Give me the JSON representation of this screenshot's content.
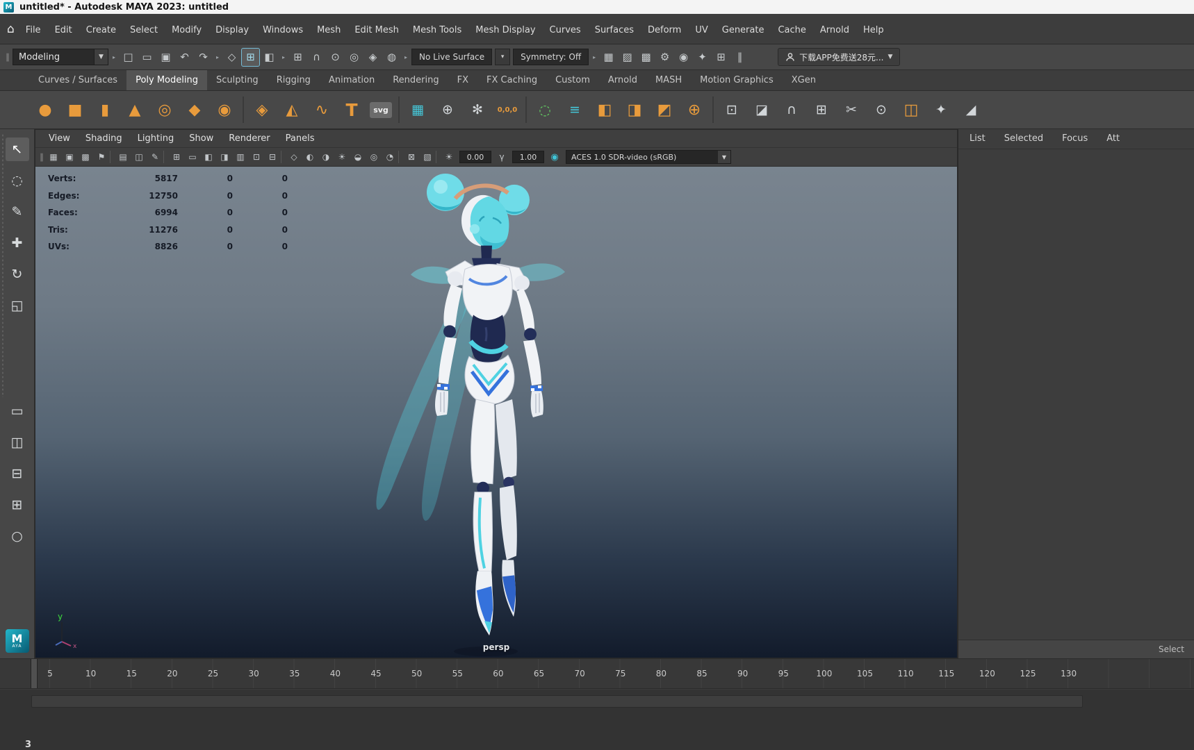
{
  "title_bar": {
    "title": "untitled* - Autodesk MAYA 2023: untitled",
    "app_icon": "M"
  },
  "icons": {
    "home": "⌂",
    "down_arrow": "▼",
    "dropdown_arrow": "▾",
    "grip": "∥",
    "separator_arrow": "▸",
    "gamma": "γ",
    "color_mgmt": "◉"
  },
  "menu_bar": {
    "items": [
      "File",
      "Edit",
      "Create",
      "Select",
      "Modify",
      "Display",
      "Windows",
      "Mesh",
      "Edit Mesh",
      "Mesh Tools",
      "Mesh Display",
      "Curves",
      "Surfaces",
      "Deform",
      "UV",
      "Generate",
      "Cache",
      "Arnold",
      "Help"
    ]
  },
  "status_line": {
    "menu_set": "Modeling",
    "file_icons": [
      {
        "name": "new-scene-icon",
        "g": "□"
      },
      {
        "name": "open-scene-icon",
        "g": "▭"
      },
      {
        "name": "save-scene-icon",
        "g": "▣"
      },
      {
        "name": "undo-icon",
        "g": "↶"
      },
      {
        "name": "redo-icon",
        "g": "↷"
      }
    ],
    "selection_mode_icons": [
      {
        "name": "select-hierarchy-mode-icon",
        "g": "◇",
        "cls": "sl-icon"
      },
      {
        "name": "select-object-mode-icon",
        "g": "⊞",
        "cls": "sl-icon active"
      },
      {
        "name": "select-component-mode-icon",
        "g": "◧",
        "cls": "sl-icon"
      }
    ],
    "snap_icons": [
      {
        "name": "snap-to-grid-icon",
        "g": "⊞"
      },
      {
        "name": "snap-to-curve-icon",
        "g": "∩"
      },
      {
        "name": "snap-to-point-icon",
        "g": "⊙"
      },
      {
        "name": "snap-to-projected-center-icon",
        "g": "◎"
      },
      {
        "name": "snap-to-view-plane-icon",
        "g": "◈"
      },
      {
        "name": "make-live-icon",
        "g": "◍"
      }
    ],
    "live_surface_label": "No Live Surface",
    "symmetry_label": "Symmetry: Off",
    "render_icons": [
      {
        "name": "open-render-view-icon",
        "g": "▦"
      },
      {
        "name": "render-current-frame-icon",
        "g": "▨"
      },
      {
        "name": "ipr-render-icon",
        "g": "▩"
      },
      {
        "name": "render-settings-icon",
        "g": "⚙"
      },
      {
        "name": "hypershade-icon",
        "g": "◉",
        "cls": "sl-icon tea"
      },
      {
        "name": "light-editor-icon",
        "g": "✦"
      },
      {
        "name": "render-setup-icon",
        "g": "⊞"
      },
      {
        "name": "pause-viewport-icon",
        "g": "∥"
      }
    ],
    "promo_label": "下载APP免费送28元..."
  },
  "shelf": {
    "left_icons": [
      {
        "name": "shelf-menu-icon",
        "g": "≡"
      },
      {
        "name": "shelf-options-gear-icon",
        "g": "⚙"
      }
    ],
    "tabs": [
      {
        "label": "Curves / Surfaces",
        "active": "false"
      },
      {
        "label": "Poly Modeling",
        "active": "true"
      },
      {
        "label": "Sculpting",
        "active": "false"
      },
      {
        "label": "Rigging",
        "active": "false"
      },
      {
        "label": "Animation",
        "active": "false"
      },
      {
        "label": "Rendering",
        "active": "false"
      },
      {
        "label": "FX",
        "active": "false"
      },
      {
        "label": "FX Caching",
        "active": "false"
      },
      {
        "label": "Custom",
        "active": "false"
      },
      {
        "label": "Arnold",
        "active": "false"
      },
      {
        "label": "MASH",
        "active": "false"
      },
      {
        "label": "Motion Graphics",
        "active": "false"
      },
      {
        "label": "XGen",
        "active": "false"
      }
    ],
    "items": [
      {
        "name": "poly-sphere-icon",
        "g": "●",
        "cls": "sh org"
      },
      {
        "name": "poly-cube-icon",
        "g": "■",
        "cls": "sh org"
      },
      {
        "name": "poly-cylinder-icon",
        "g": "▮",
        "cls": "sh org"
      },
      {
        "name": "poly-cone-icon",
        "g": "▲",
        "cls": "sh org"
      },
      {
        "name": "poly-torus-icon",
        "g": "◎",
        "cls": "sh org"
      },
      {
        "name": "poly-plane-icon",
        "g": "◆",
        "cls": "sh org"
      },
      {
        "name": "poly-disc-icon",
        "g": "◉",
        "cls": "sh org"
      },
      {
        "name": "shelf-separator",
        "g": "",
        "cls": "sh sep",
        "inter": "false"
      },
      {
        "name": "platonic-solid-icon",
        "g": "◈",
        "cls": "sh org"
      },
      {
        "name": "poly-pyramid-icon",
        "g": "◭",
        "cls": "sh org"
      },
      {
        "name": "poly-helix-icon",
        "g": "∿",
        "cls": "sh org"
      },
      {
        "name": "poly-type-icon",
        "g": "T",
        "cls": "sh org t"
      },
      {
        "name": "svg-tool-icon",
        "g": "svg",
        "cls": "sh badge"
      },
      {
        "name": "shelf-separator",
        "g": "",
        "cls": "sh sep",
        "inter": "false"
      },
      {
        "name": "sweep-mesh-icon",
        "g": "▦",
        "cls": "sh tea"
      },
      {
        "name": "center-pivot-icon",
        "g": "⊕",
        "cls": "sh gry"
      },
      {
        "name": "freeze-transformations-icon",
        "g": "✻",
        "cls": "sh gry"
      },
      {
        "name": "reset-transformations-icon",
        "g": "0,0,0",
        "cls": "sh num"
      },
      {
        "name": "shelf-separator",
        "g": "",
        "cls": "sh sep",
        "inter": "false"
      },
      {
        "name": "selection-constraint-icon",
        "g": "◌",
        "cls": "sh grn"
      },
      {
        "name": "smooth-mesh-preview-icon",
        "g": "≡",
        "cls": "sh tea"
      },
      {
        "name": "combine-icon",
        "g": "◧",
        "cls": "sh org"
      },
      {
        "name": "separate-icon",
        "g": "◨",
        "cls": "sh org"
      },
      {
        "name": "extract-icon",
        "g": "◩",
        "cls": "sh org"
      },
      {
        "name": "boolean-icon",
        "g": "⊕",
        "cls": "sh org"
      },
      {
        "name": "shelf-separator",
        "g": "",
        "cls": "sh sep",
        "inter": "false"
      },
      {
        "name": "extrude-icon",
        "g": "⊡",
        "cls": "sh gry"
      },
      {
        "name": "bevel-icon",
        "g": "◪",
        "cls": "sh gry"
      },
      {
        "name": "bridge-icon",
        "g": "∩",
        "cls": "sh gry"
      },
      {
        "name": "quad-draw-icon",
        "g": "⊞",
        "cls": "sh gry"
      },
      {
        "name": "multi-cut-icon",
        "g": "✂",
        "cls": "sh gry"
      },
      {
        "name": "target-weld-icon",
        "g": "⊙",
        "cls": "sh gry"
      },
      {
        "name": "mirror-icon",
        "g": "◫",
        "cls": "sh org"
      },
      {
        "name": "smooth-icon",
        "g": "✦",
        "cls": "sh gry"
      },
      {
        "name": "crease-icon",
        "g": "◢",
        "cls": "sh gry"
      }
    ]
  },
  "toolbox": {
    "tools": [
      {
        "name": "select-tool",
        "g": "↖",
        "cls": "tb-item active"
      },
      {
        "name": "lasso-tool",
        "g": "◌",
        "cls": "tb-item"
      },
      {
        "name": "paint-select-tool",
        "g": "✎",
        "cls": "tb-item"
      },
      {
        "name": "move-tool",
        "g": "✚",
        "cls": "tb-item"
      },
      {
        "name": "rotate-tool",
        "g": "↻",
        "cls": "tb-item"
      },
      {
        "name": "scale-tool",
        "g": "◱",
        "cls": "tb-item"
      }
    ],
    "layouts": [
      {
        "name": "single-pane-layout",
        "g": "▭"
      },
      {
        "name": "two-pane-side-layout",
        "g": "◫"
      },
      {
        "name": "two-pane-stacked-layout",
        "g": "⊟"
      },
      {
        "name": "four-pane-layout",
        "g": "⊞"
      },
      {
        "name": "zoom-tool",
        "g": "○"
      }
    ],
    "logo": "M",
    "logo_sub": "AYA"
  },
  "viewport": {
    "menus": [
      "View",
      "Shading",
      "Lighting",
      "Show",
      "Renderer",
      "Panels"
    ],
    "toolbar_icons": [
      {
        "name": "panel-grip",
        "g": "∥",
        "cls": "vp-icon vp-grip",
        "inter": "false"
      },
      {
        "name": "select-camera-icon",
        "g": "▦"
      },
      {
        "name": "lock-camera-icon",
        "g": "▣"
      },
      {
        "name": "camera-attributes-icon",
        "g": "▩"
      },
      {
        "name": "bookmark-icon",
        "g": "⚑"
      },
      {
        "name": "toolbar-separator",
        "g": "",
        "cls": "vp-icon vp-sep",
        "inter": "false"
      },
      {
        "name": "image-plane-icon",
        "g": "▤"
      },
      {
        "name": "two-d-pan-zoom-icon",
        "g": "◫"
      },
      {
        "name": "grease-pencil-icon",
        "g": "✎"
      },
      {
        "name": "toolbar-separator",
        "g": "",
        "cls": "vp-icon vp-sep",
        "inter": "false"
      },
      {
        "name": "grid-toggle-icon",
        "g": "⊞"
      },
      {
        "name": "film-gate-icon",
        "g": "▭"
      },
      {
        "name": "resolution-gate-icon",
        "g": "◧"
      },
      {
        "name": "gate-mask-icon",
        "g": "◨"
      },
      {
        "name": "field-chart-icon",
        "g": "▥"
      },
      {
        "name": "safe-action-icon",
        "g": "⊡"
      },
      {
        "name": "safe-title-icon",
        "g": "⊟"
      },
      {
        "name": "toolbar-separator",
        "g": "",
        "cls": "vp-icon vp-sep",
        "inter": "false"
      },
      {
        "name": "wireframe-mode-icon",
        "g": "◇"
      },
      {
        "name": "shaded-mode-icon",
        "g": "◐"
      },
      {
        "name": "textured-mode-icon",
        "g": "◑"
      },
      {
        "name": "use-all-lights-icon",
        "g": "☀"
      },
      {
        "name": "shadows-icon",
        "g": "◒"
      },
      {
        "name": "screen-space-ao-icon",
        "g": "◎"
      },
      {
        "name": "motion-blur-icon",
        "g": "◔"
      },
      {
        "name": "toolbar-separator",
        "g": "",
        "cls": "vp-icon vp-sep",
        "inter": "false"
      },
      {
        "name": "isolate-select-icon",
        "g": "⊠"
      },
      {
        "name": "xray-icon",
        "g": "▧"
      },
      {
        "name": "toolbar-separator",
        "g": "",
        "cls": "vp-icon vp-sep",
        "inter": "false"
      },
      {
        "name": "exposure-icon",
        "g": "☀"
      }
    ],
    "exposure": "0.00",
    "gamma": "1.00",
    "view_transform": "ACES 1.0 SDR-video (sRGB)",
    "camera_label": "persp",
    "hud": {
      "rows": [
        {
          "label": "Verts:",
          "total": "5817",
          "sel": "0",
          "other": "0"
        },
        {
          "label": "Edges:",
          "total": "12750",
          "sel": "0",
          "other": "0"
        },
        {
          "label": "Faces:",
          "total": "6994",
          "sel": "0",
          "other": "0"
        },
        {
          "label": "Tris:",
          "total": "11276",
          "sel": "0",
          "other": "0"
        },
        {
          "label": "UVs:",
          "total": "8826",
          "sel": "0",
          "other": "0"
        }
      ]
    }
  },
  "right_panel": {
    "tabs": [
      "List",
      "Selected",
      "Focus",
      "Attributes"
    ],
    "footer_label": "Select"
  },
  "timeline": {
    "ticks": [
      "5",
      "10",
      "15",
      "20",
      "25",
      "30",
      "35",
      "40",
      "45",
      "50",
      "55",
      "60",
      "65",
      "70",
      "75",
      "80",
      "85",
      "90",
      "95",
      "100",
      "105",
      "110",
      "115",
      "120",
      "125",
      "130"
    ],
    "current_frame": "3"
  }
}
